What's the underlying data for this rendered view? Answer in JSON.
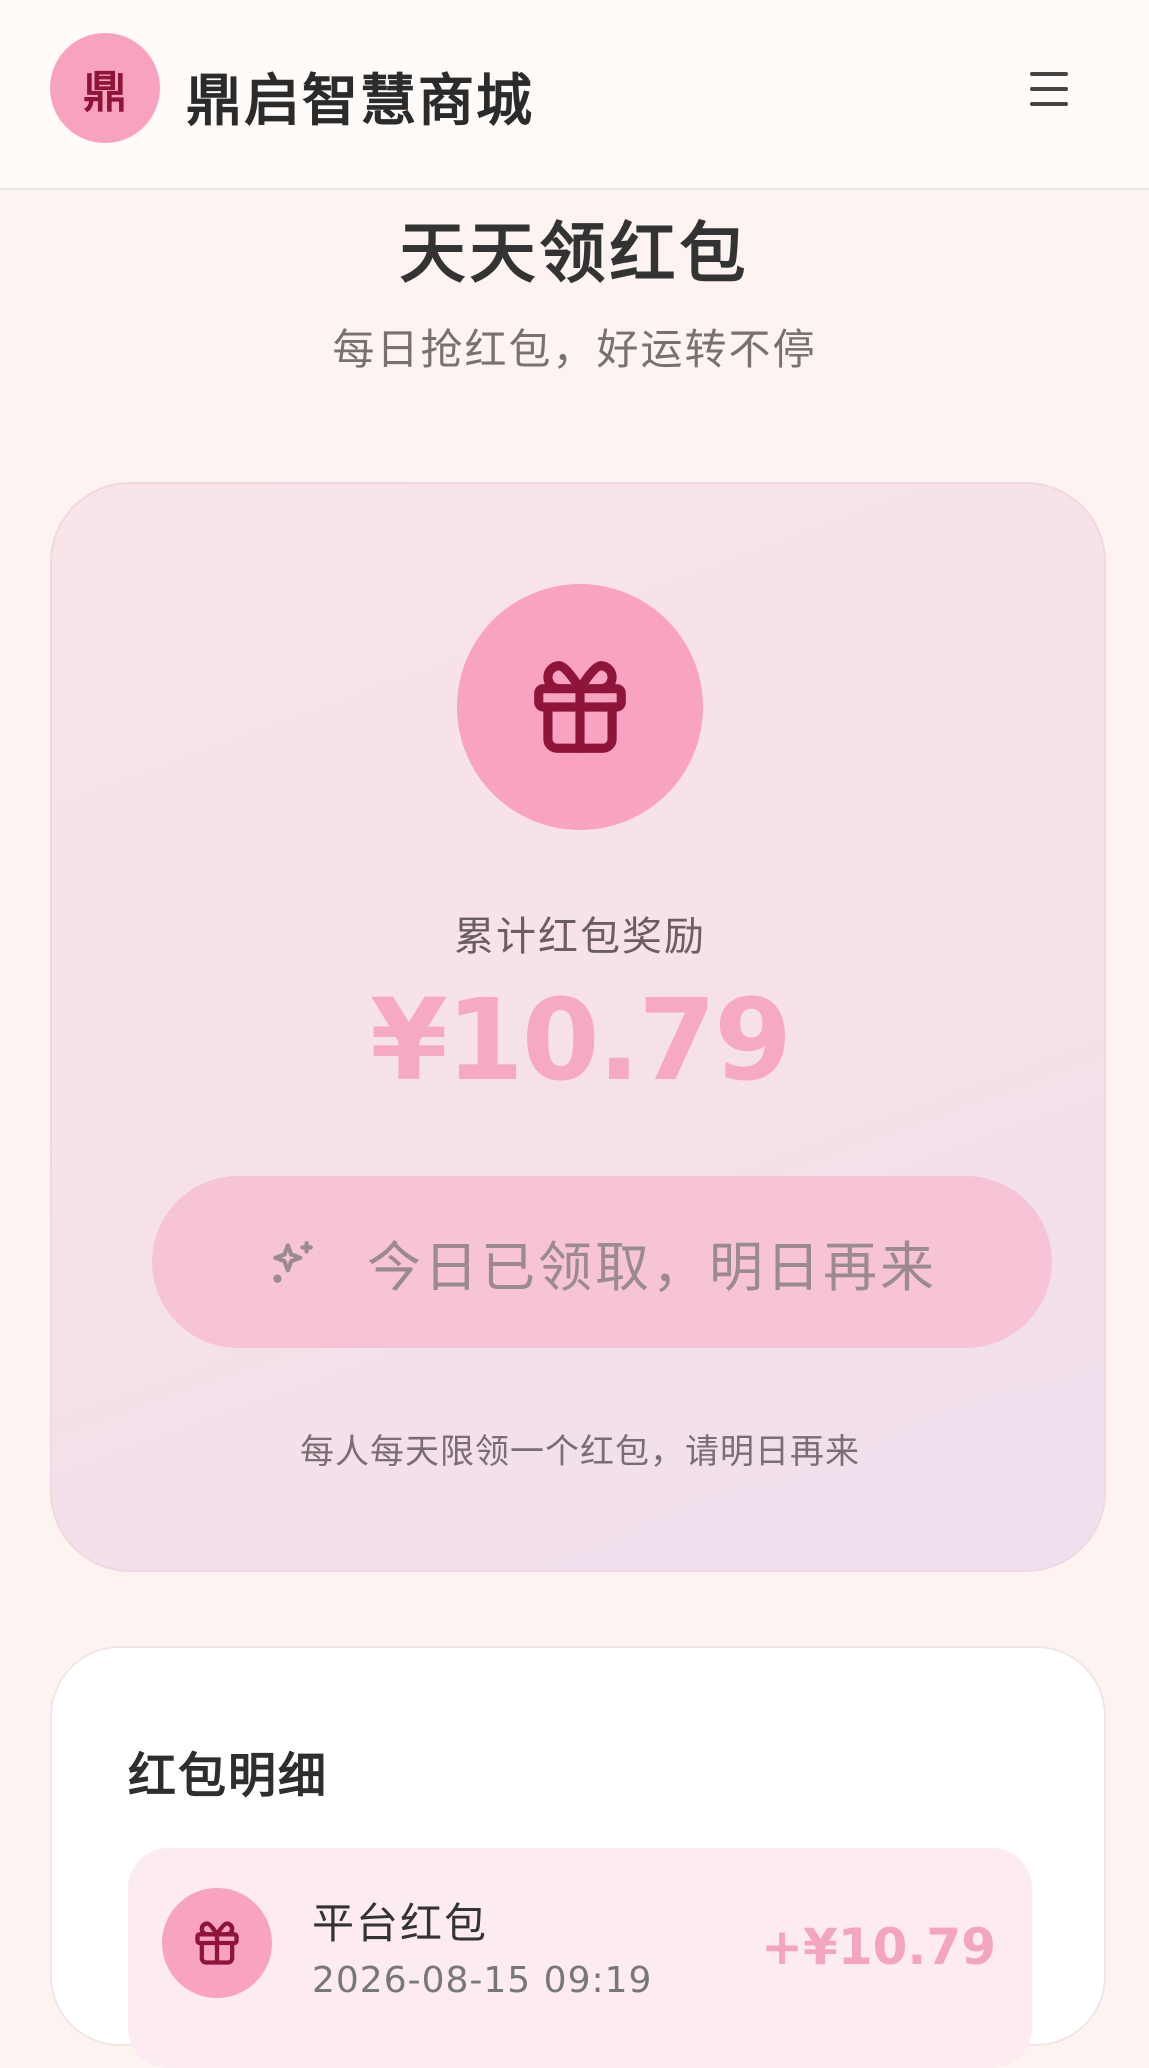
{
  "header": {
    "logo_char": "鼎",
    "app_title": "鼎启智慧商城",
    "menu_icon": "hamburger-menu-icon"
  },
  "main": {
    "title": "天天领红包",
    "subtitle": "每日抢红包，好运转不停"
  },
  "reward_card": {
    "icon": "gift-icon",
    "label": "累计红包奖励",
    "amount": "¥10.79",
    "button_icon": "sparkle-icon",
    "button_label": "今日已领取，明日再来",
    "note": "每人每天限领一个红包，请明日再来"
  },
  "details": {
    "title": "红包明细",
    "records": [
      {
        "icon": "gift-icon",
        "name": "平台红包",
        "time": "2026-08-15 09:19",
        "amount": "+¥10.79"
      }
    ]
  },
  "colors": {
    "accent_pink": "#f7a3c1",
    "icon_dark": "#8e1439",
    "amount_pink": "#f5a9c2"
  }
}
